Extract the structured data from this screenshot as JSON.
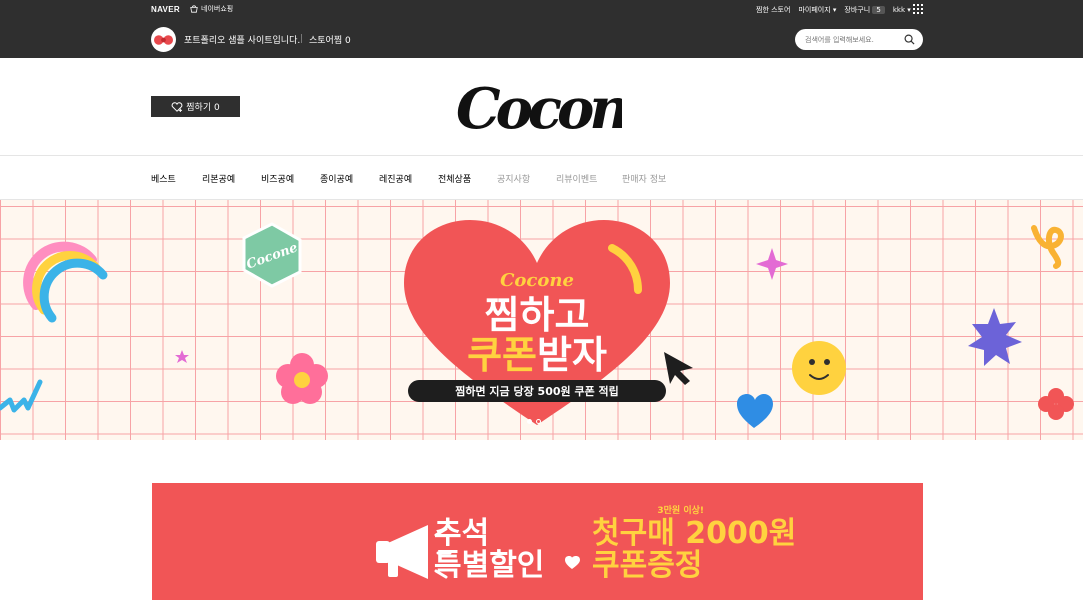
{
  "topbar": {
    "naver_logo": "NAVER",
    "shopping_label": "네이버쇼핑",
    "links": [
      "찜한 스토어",
      "마이페이지 ▾",
      "장바구니"
    ],
    "cart_count": "5",
    "user": "kkk ▾"
  },
  "store": {
    "title": "포트폴리오 샘플 사이트입니다.",
    "favorite_label": "스토어찜 0",
    "search_placeholder": "검색어를 입력해보세요."
  },
  "header": {
    "zzim_button": "찜하기 0",
    "brand_logo": "Cocone"
  },
  "nav": {
    "items": [
      {
        "label": "베스트",
        "dim": false
      },
      {
        "label": "리본공예",
        "dim": false
      },
      {
        "label": "비즈공예",
        "dim": false
      },
      {
        "label": "종이공예",
        "dim": false
      },
      {
        "label": "레진공예",
        "dim": false
      },
      {
        "label": "전체상품",
        "dim": false
      },
      {
        "label": "공지사항",
        "dim": true
      },
      {
        "label": "리뷰이벤트",
        "dim": true
      },
      {
        "label": "판매자 정보",
        "dim": true
      }
    ]
  },
  "hero": {
    "brand": "Cocone",
    "badge_text": "Cocone",
    "headline_line1": "찜하고",
    "headline_line2_a": "쿠폰",
    "headline_line2_b": "받자",
    "sub": "찜하면 지금 당장 500원 쿠폰 적립",
    "slide_count": 2,
    "active_slide": 1
  },
  "promo": {
    "tag": "3만원 이상!",
    "left_line1": "추석",
    "left_line2": "특별할인",
    "right_line1": "첫구매 2000원",
    "right_line2": "쿠폰증정"
  },
  "colors": {
    "dark": "#2f2f2f",
    "heart": "#f15556",
    "grid": "#f7a3a6",
    "hero_bg": "#fff7ef",
    "yellow": "#ffd23f",
    "promo_bg": "#f15556"
  }
}
